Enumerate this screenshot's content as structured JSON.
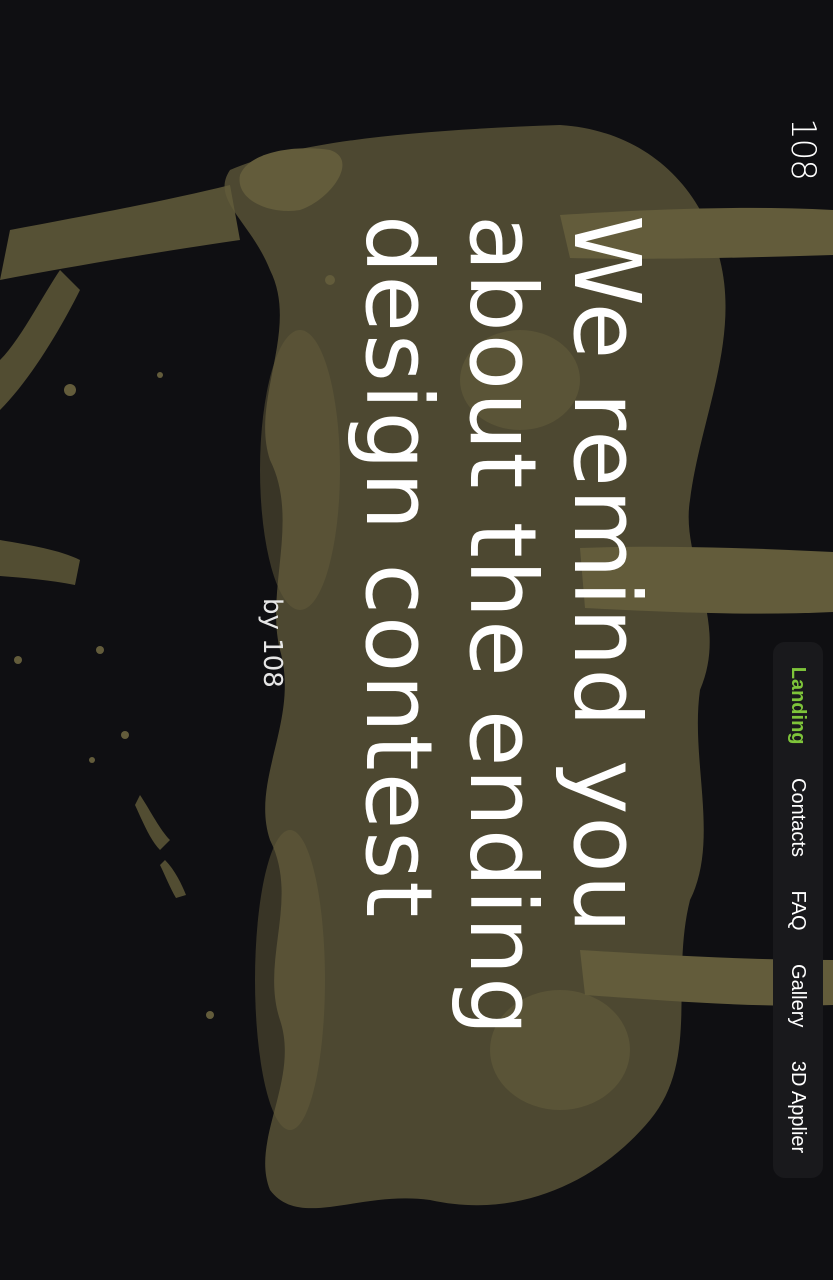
{
  "colors": {
    "background": "#0f0f12",
    "splash": "#6b6440",
    "accent": "#7ec43a",
    "nav_background": "#19191c"
  },
  "header": {
    "logo": "108"
  },
  "hero": {
    "title": "We remind you\nabout the ending\ndesign contest",
    "byline": "by 108",
    "background_image": "cream-liquid-splash"
  },
  "nav": {
    "items": [
      {
        "label": "Landing",
        "active": true
      },
      {
        "label": "Contacts",
        "active": false
      },
      {
        "label": "FAQ",
        "active": false
      },
      {
        "label": "Gallery",
        "active": false
      },
      {
        "label": "3D Applier",
        "active": false
      }
    ]
  }
}
